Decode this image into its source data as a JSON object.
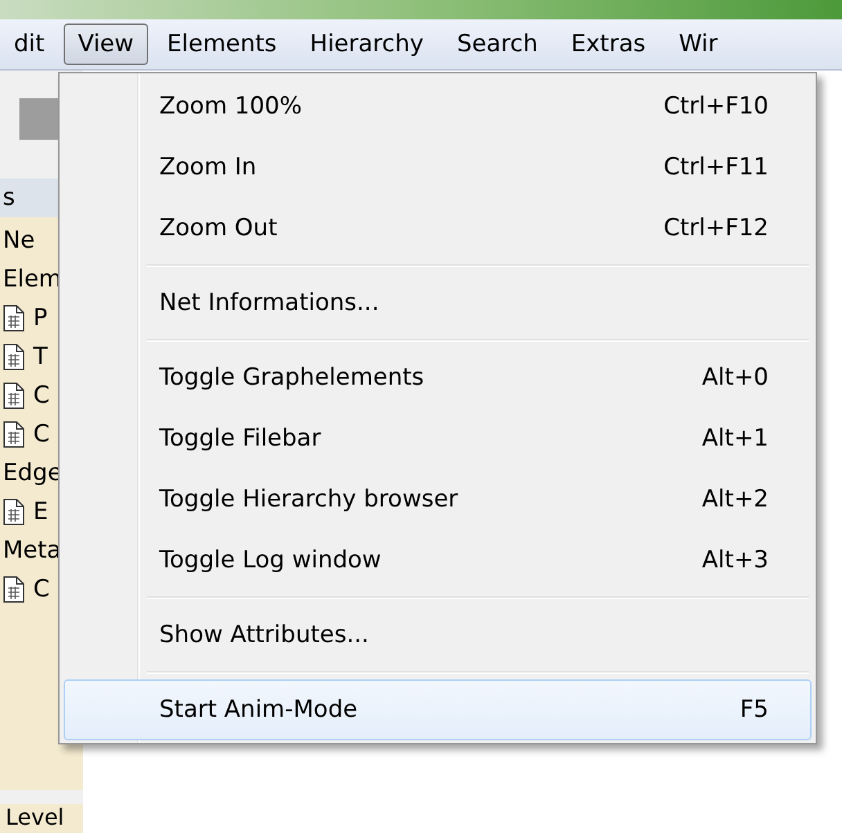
{
  "menubar": [
    {
      "label": "dit",
      "selected": false
    },
    {
      "label": "View",
      "selected": true
    },
    {
      "label": "Elements",
      "selected": false
    },
    {
      "label": "Hierarchy",
      "selected": false
    },
    {
      "label": "Search",
      "selected": false
    },
    {
      "label": "Extras",
      "selected": false
    },
    {
      "label": "Wir",
      "selected": false
    }
  ],
  "sidebar": {
    "header": "s",
    "items": [
      {
        "kind": "group",
        "label": "Ne"
      },
      {
        "kind": "group",
        "label": "Elem"
      },
      {
        "kind": "file",
        "label": "P"
      },
      {
        "kind": "file",
        "label": "T"
      },
      {
        "kind": "file",
        "label": "C"
      },
      {
        "kind": "file",
        "label": "C"
      },
      {
        "kind": "group",
        "label": "Edge"
      },
      {
        "kind": "file",
        "label": "E"
      },
      {
        "kind": "group",
        "label": "Meta"
      },
      {
        "kind": "file",
        "label": "C"
      }
    ],
    "footer": "Level"
  },
  "menu": [
    {
      "kind": "item",
      "label": "Zoom 100%",
      "shortcut": "Ctrl+F10",
      "highlighted": false
    },
    {
      "kind": "item",
      "label": "Zoom In",
      "shortcut": "Ctrl+F11",
      "highlighted": false
    },
    {
      "kind": "item",
      "label": "Zoom Out",
      "shortcut": "Ctrl+F12",
      "highlighted": false
    },
    {
      "kind": "separator"
    },
    {
      "kind": "item",
      "label": "Net Informations...",
      "highlighted": false
    },
    {
      "kind": "separator"
    },
    {
      "kind": "item",
      "label": "Toggle Graphelements",
      "shortcut": "Alt+0",
      "highlighted": false
    },
    {
      "kind": "item",
      "label": "Toggle Filebar",
      "shortcut": "Alt+1",
      "highlighted": false
    },
    {
      "kind": "item",
      "label": "Toggle Hierarchy browser",
      "shortcut": "Alt+2",
      "highlighted": false
    },
    {
      "kind": "item",
      "label": "Toggle Log window",
      "shortcut": "Alt+3",
      "highlighted": false
    },
    {
      "kind": "separator"
    },
    {
      "kind": "item",
      "label": "Show Attributes...",
      "highlighted": false
    },
    {
      "kind": "separator"
    },
    {
      "kind": "item",
      "label": "Start Anim-Mode",
      "shortcut": "F5",
      "highlighted": true
    }
  ]
}
